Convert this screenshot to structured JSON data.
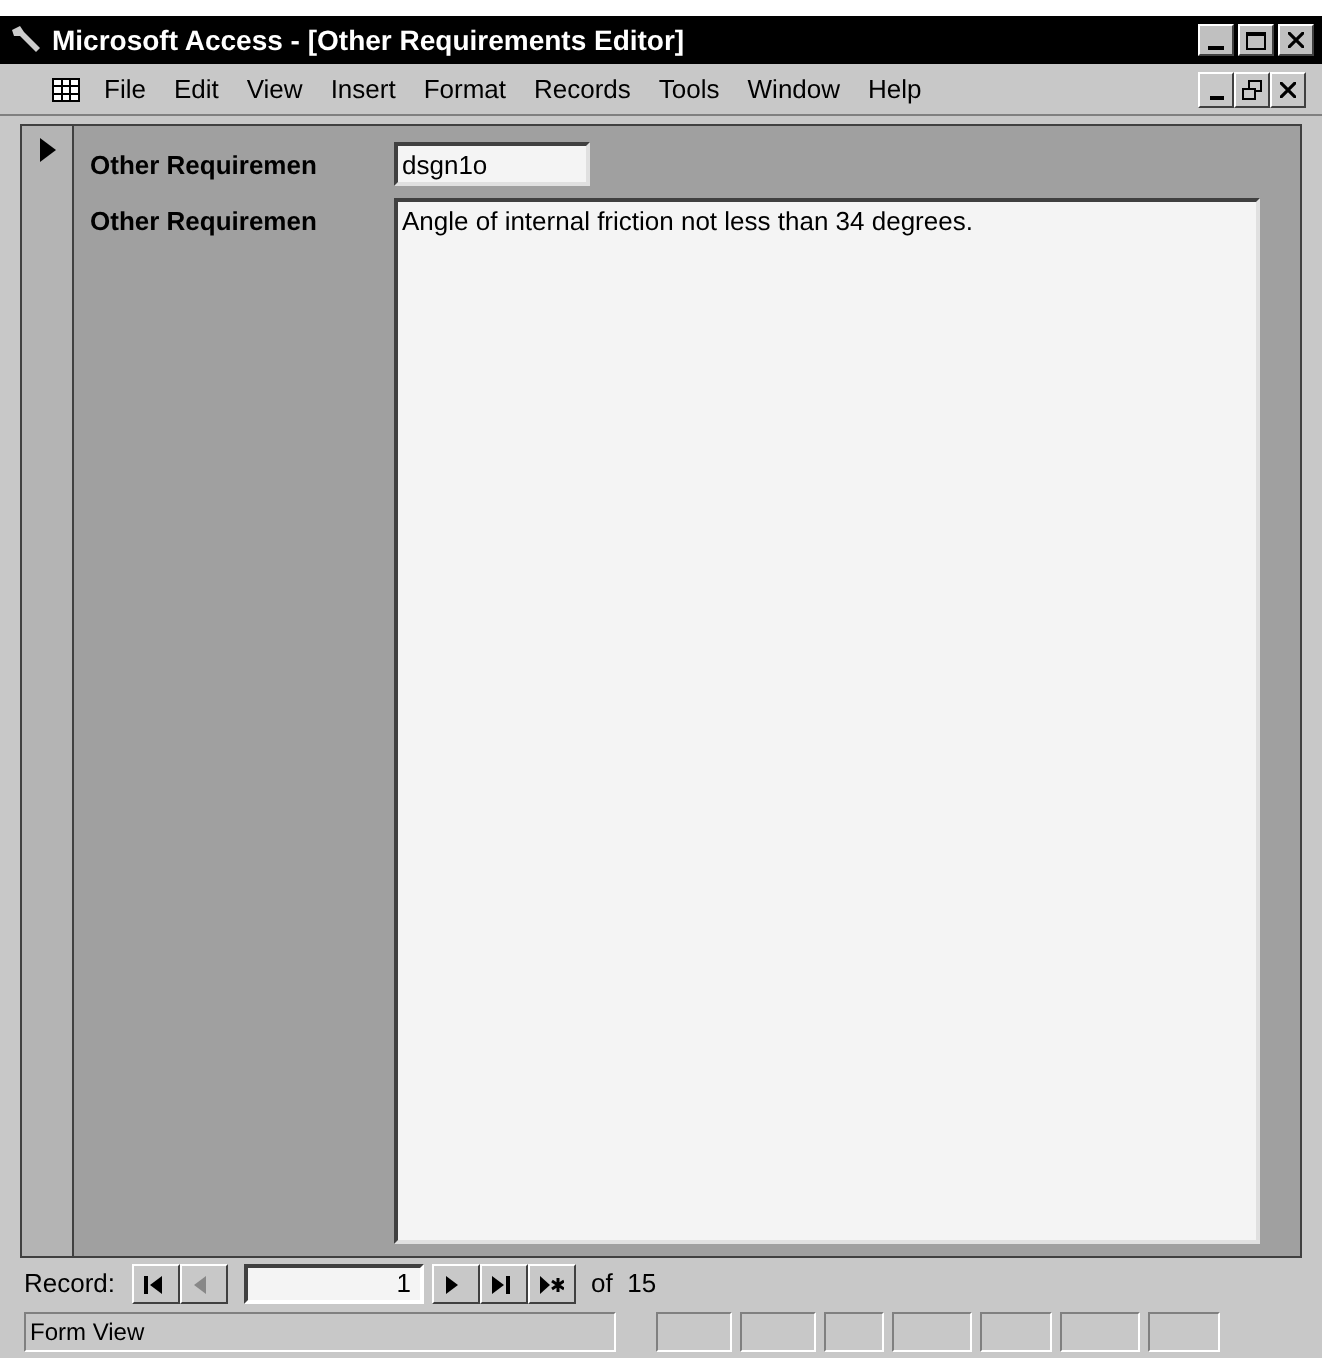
{
  "window": {
    "title": "Microsoft Access - [Other Requirements Editor]"
  },
  "menu": [
    "File",
    "Edit",
    "View",
    "Insert",
    "Format",
    "Records",
    "Tools",
    "Window",
    "Help"
  ],
  "form": {
    "fields": [
      {
        "label": "Other Requiremen",
        "value": "dsgn1o",
        "kind": "short"
      },
      {
        "label": "Other Requiremen",
        "value": "Angle of internal friction not less than 34 degrees.",
        "kind": "memo"
      }
    ]
  },
  "navigation": {
    "label": "Record:",
    "buttons": [
      {
        "kind": "first",
        "disabled": false
      },
      {
        "kind": "prev",
        "disabled": true
      }
    ],
    "current": "1",
    "buttons_after": [
      {
        "kind": "next",
        "disabled": false
      },
      {
        "kind": "last",
        "disabled": false
      },
      {
        "kind": "new",
        "disabled": false
      }
    ],
    "total": "of  15"
  },
  "status_bar": {
    "text": "Form View"
  }
}
